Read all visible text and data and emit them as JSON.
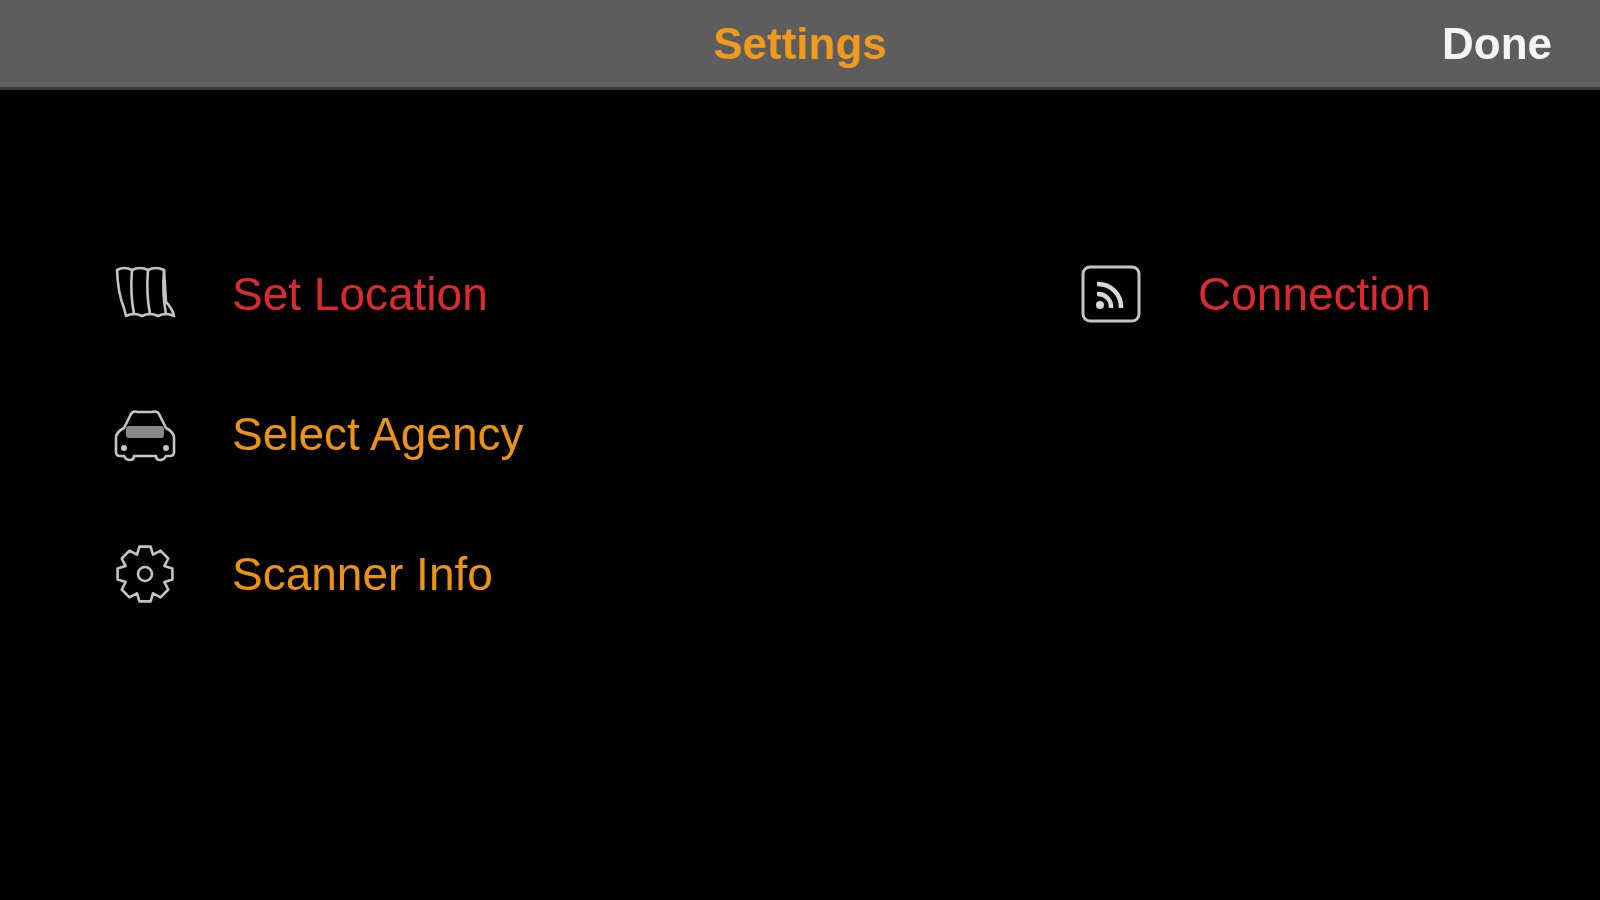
{
  "header": {
    "title": "Settings",
    "done_button": "Done"
  },
  "columns": [
    {
      "items": [
        {
          "kind": "map",
          "label": "Set Location",
          "color": "#d92a30"
        },
        {
          "kind": "car",
          "label": "Select Agency",
          "color": "#eb9413"
        },
        {
          "kind": "gear",
          "label": "Scanner Info",
          "color": "#eb9413"
        }
      ]
    },
    {
      "items": [
        {
          "kind": "feed",
          "label": "Connection",
          "color": "#d92a30"
        }
      ]
    }
  ]
}
